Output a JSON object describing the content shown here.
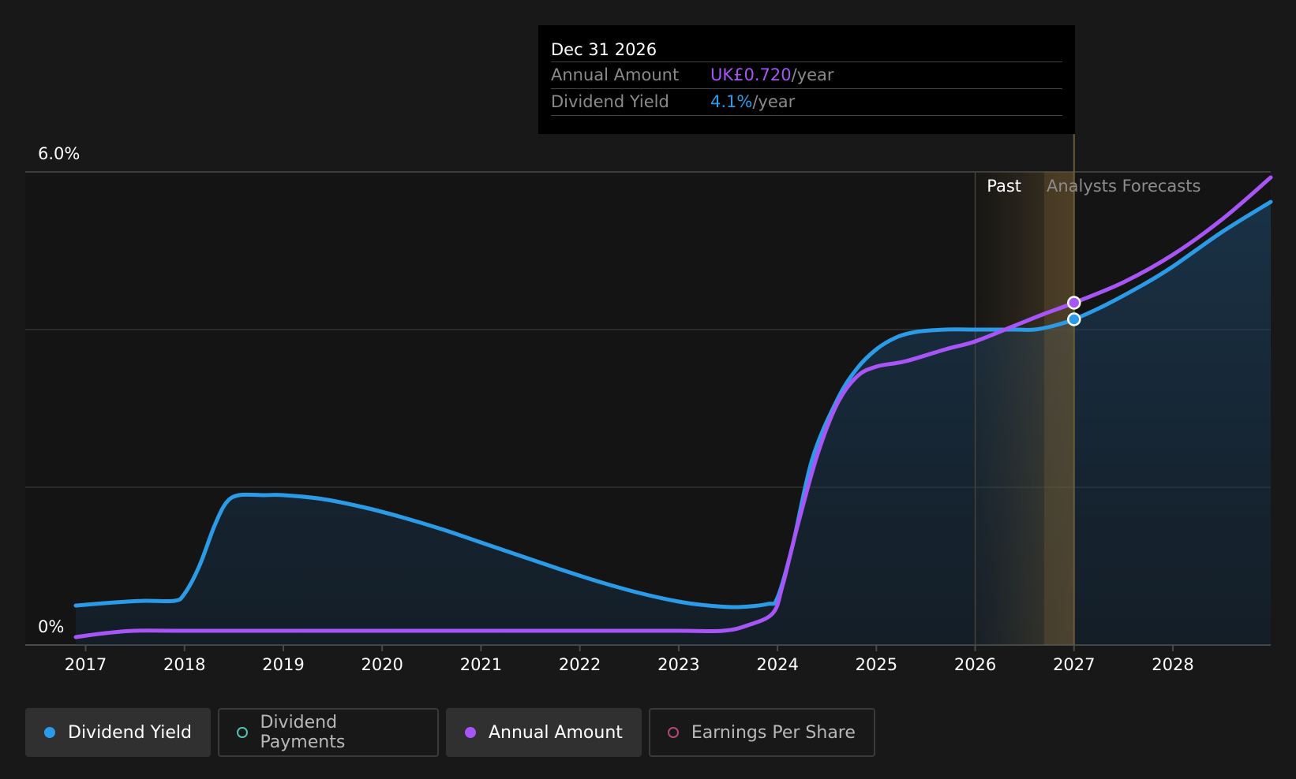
{
  "tooltip": {
    "date": "Dec 31 2026",
    "rows": [
      {
        "label": "Annual Amount",
        "value": "UK£0.720",
        "unit": "/year",
        "color": "#a855f7"
      },
      {
        "label": "Dividend Yield",
        "value": "4.1%",
        "unit": "/year",
        "color": "#2b9be8"
      }
    ]
  },
  "legend": [
    {
      "label": "Dividend Yield",
      "color": "#2b9be8",
      "filled": true,
      "active": true
    },
    {
      "label": "Dividend Payments",
      "color": "#4fc3b0",
      "filled": false,
      "active": false
    },
    {
      "label": "Annual Amount",
      "color": "#a855f7",
      "filled": true,
      "active": true
    },
    {
      "label": "Earnings Per Share",
      "color": "#b04a7a",
      "filled": false,
      "active": false
    }
  ],
  "chart_data": {
    "type": "line",
    "y_tick_labels": [
      "6.0%",
      "0%"
    ],
    "ylim": [
      0,
      6.0
    ],
    "xlim": [
      2016.9,
      2028.99
    ],
    "x_ticks": [
      "2017",
      "2018",
      "2019",
      "2020",
      "2021",
      "2022",
      "2023",
      "2024",
      "2025",
      "2026",
      "2027",
      "2028"
    ],
    "gridlines": [
      2,
      4,
      6
    ],
    "region_labels": {
      "past": "Past",
      "forecast": "Analysts Forecasts"
    },
    "past_region": [
      2026.0,
      2027.0
    ],
    "marker_x": 2027.0,
    "series": [
      {
        "name": "Dividend Yield",
        "color": "#2b9be8",
        "points": [
          [
            2016.9,
            0.5
          ],
          [
            2017.3,
            0.54
          ],
          [
            2017.6,
            0.56
          ],
          [
            2017.9,
            0.56
          ],
          [
            2018.0,
            0.65
          ],
          [
            2018.15,
            1.0
          ],
          [
            2018.3,
            1.5
          ],
          [
            2018.42,
            1.8
          ],
          [
            2018.55,
            1.9
          ],
          [
            2018.8,
            1.9
          ],
          [
            2019.0,
            1.9
          ],
          [
            2019.4,
            1.85
          ],
          [
            2019.8,
            1.75
          ],
          [
            2020.2,
            1.62
          ],
          [
            2020.6,
            1.47
          ],
          [
            2021.0,
            1.3
          ],
          [
            2021.4,
            1.13
          ],
          [
            2021.8,
            0.96
          ],
          [
            2022.2,
            0.8
          ],
          [
            2022.6,
            0.66
          ],
          [
            2023.0,
            0.55
          ],
          [
            2023.3,
            0.5
          ],
          [
            2023.6,
            0.48
          ],
          [
            2023.9,
            0.52
          ],
          [
            2024.0,
            0.6
          ],
          [
            2024.15,
            1.25
          ],
          [
            2024.35,
            2.35
          ],
          [
            2024.6,
            3.1
          ],
          [
            2024.8,
            3.5
          ],
          [
            2025.0,
            3.75
          ],
          [
            2025.2,
            3.9
          ],
          [
            2025.4,
            3.97
          ],
          [
            2025.7,
            4.0
          ],
          [
            2026.0,
            4.0
          ],
          [
            2026.4,
            4.0
          ],
          [
            2026.6,
            4.0
          ],
          [
            2026.8,
            4.05
          ],
          [
            2027.0,
            4.13
          ],
          [
            2027.3,
            4.3
          ],
          [
            2027.7,
            4.57
          ],
          [
            2028.0,
            4.8
          ],
          [
            2028.5,
            5.24
          ],
          [
            2028.99,
            5.62
          ]
        ]
      },
      {
        "name": "Annual Amount",
        "color": "#a855f7",
        "points": [
          [
            2016.9,
            0.1
          ],
          [
            2017.2,
            0.15
          ],
          [
            2017.5,
            0.18
          ],
          [
            2018.0,
            0.18
          ],
          [
            2019.0,
            0.18
          ],
          [
            2020.0,
            0.18
          ],
          [
            2021.0,
            0.18
          ],
          [
            2022.0,
            0.18
          ],
          [
            2023.0,
            0.18
          ],
          [
            2023.45,
            0.18
          ],
          [
            2023.7,
            0.25
          ],
          [
            2023.95,
            0.4
          ],
          [
            2024.05,
            0.75
          ],
          [
            2024.2,
            1.5
          ],
          [
            2024.4,
            2.4
          ],
          [
            2024.6,
            3.05
          ],
          [
            2024.8,
            3.4
          ],
          [
            2025.0,
            3.53
          ],
          [
            2025.3,
            3.6
          ],
          [
            2025.7,
            3.75
          ],
          [
            2026.0,
            3.85
          ],
          [
            2026.4,
            4.05
          ],
          [
            2026.7,
            4.2
          ],
          [
            2027.0,
            4.34
          ],
          [
            2027.5,
            4.6
          ],
          [
            2028.0,
            4.95
          ],
          [
            2028.5,
            5.4
          ],
          [
            2028.99,
            5.93
          ]
        ]
      }
    ],
    "highlight_points": [
      {
        "series": "Annual Amount",
        "x": 2027.0,
        "y": 4.34
      },
      {
        "series": "Dividend Yield",
        "x": 2027.0,
        "y": 4.13
      }
    ]
  }
}
